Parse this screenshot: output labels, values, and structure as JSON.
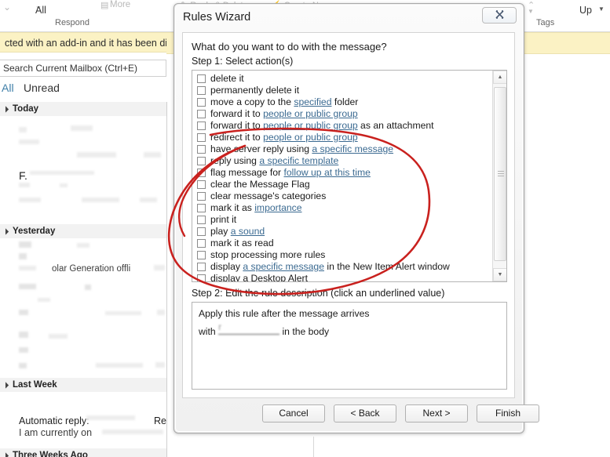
{
  "background": {
    "ribbon": {
      "all_label": "All",
      "more_label": "More",
      "respond_group": "Respond",
      "tags_group": "Tags",
      "up_label": "Up"
    },
    "warning_bar": {
      "text": "cted with an add-in and it has been dis"
    },
    "search": {
      "placeholder": "Search Current Mailbox (Ctrl+E)",
      "value": "Search Current Mailbox (Ctrl+E)"
    },
    "filters": {
      "all": "All",
      "unread": "Unread"
    },
    "mail_groups": [
      {
        "label": "Today"
      },
      {
        "label": "Yesterday"
      },
      {
        "label": "Last Week"
      },
      {
        "label": "Three Weeks Ago"
      }
    ],
    "mail_items": [
      {
        "subject_fragment": "F.",
        "partial": "olar Generation offli"
      },
      {
        "auto_reply_subject": "Automatic reply:",
        "auto_reply_ref": "Ref",
        "auto_reply_preview": "I am currently on"
      }
    ]
  },
  "dialog": {
    "title": "Rules Wizard",
    "close_icon": "close-icon",
    "question": "What do you want to do with the message?",
    "step1_label": "Step 1: Select action(s)",
    "actions": [
      {
        "pre": "delete it",
        "link": "",
        "post": "",
        "checked": false
      },
      {
        "pre": "permanently delete it",
        "link": "",
        "post": "",
        "checked": false
      },
      {
        "pre": "move a copy to the ",
        "link": "specified",
        "post": " folder",
        "checked": false
      },
      {
        "pre": "forward it to ",
        "link": "people or public group",
        "post": "",
        "checked": false
      },
      {
        "pre": "forward it to ",
        "link": "people or public group",
        "post": " as an attachment",
        "checked": false
      },
      {
        "pre": "redirect it to ",
        "link": "people or public group",
        "post": "",
        "checked": false
      },
      {
        "pre": "have server reply using ",
        "link": "a specific message",
        "post": "",
        "checked": false
      },
      {
        "pre": "reply using ",
        "link": "a specific template",
        "post": "",
        "checked": false
      },
      {
        "pre": "flag message for ",
        "link": "follow up at this time",
        "post": "",
        "checked": false
      },
      {
        "pre": "clear the Message Flag",
        "link": "",
        "post": "",
        "checked": false
      },
      {
        "pre": "clear message's categories",
        "link": "",
        "post": "",
        "checked": false
      },
      {
        "pre": "mark it as ",
        "link": "importance",
        "post": "",
        "checked": false
      },
      {
        "pre": "print it",
        "link": "",
        "post": "",
        "checked": false
      },
      {
        "pre": "play ",
        "link": "a sound",
        "post": "",
        "checked": false
      },
      {
        "pre": "mark it as read",
        "link": "",
        "post": "",
        "checked": false
      },
      {
        "pre": "stop processing more rules",
        "link": "",
        "post": "",
        "checked": false
      },
      {
        "pre": "display ",
        "link": "a specific message",
        "post": " in the New Item Alert window",
        "checked": false
      },
      {
        "pre": "display a Desktop Alert",
        "link": "",
        "post": "",
        "checked": false
      }
    ],
    "scrollbar": {
      "up_arrow": "▲",
      "down_arrow": "▼"
    },
    "step2_label": "Step 2: Edit the rule description (click an underlined value)",
    "description": {
      "line1": "Apply this rule after the message arrives",
      "line2_pre": "with ",
      "line2_redacted": "r",
      "line2_post": " in the body"
    },
    "buttons": {
      "cancel": "Cancel",
      "back": "< Back",
      "next": "Next >",
      "finish": "Finish"
    }
  },
  "annotation": {
    "type": "hand-drawn-ellipse",
    "color": "#c9211e",
    "target": "action list items"
  }
}
